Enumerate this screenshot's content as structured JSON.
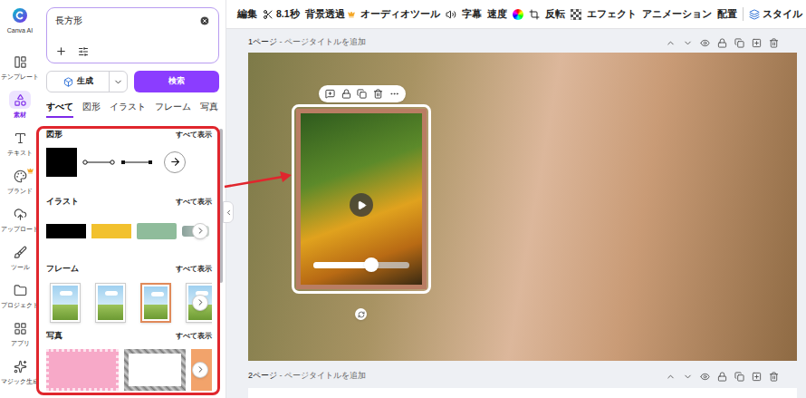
{
  "rail": {
    "logo": "Canva AI",
    "items": [
      {
        "label": "テンプレート",
        "selected": false,
        "premium": false
      },
      {
        "label": "素材",
        "selected": true,
        "premium": false
      },
      {
        "label": "テキスト",
        "selected": false,
        "premium": false
      },
      {
        "label": "ブランド",
        "selected": false,
        "premium": true
      },
      {
        "label": "アップロード",
        "selected": false,
        "premium": false
      },
      {
        "label": "ツール",
        "selected": false,
        "premium": false
      },
      {
        "label": "プロジェクト",
        "selected": false,
        "premium": false
      },
      {
        "label": "アプリ",
        "selected": false,
        "premium": false
      },
      {
        "label": "マジック生成",
        "selected": false,
        "premium": false
      }
    ]
  },
  "search": {
    "value": "長方形"
  },
  "buttons": {
    "generate": "生成",
    "search": "検索"
  },
  "tabs": [
    {
      "label": "すべて",
      "selected": true
    },
    {
      "label": "図形",
      "selected": false
    },
    {
      "label": "イラスト",
      "selected": false
    },
    {
      "label": "フレーム",
      "selected": false
    },
    {
      "label": "写真",
      "selected": false
    }
  ],
  "sections": [
    {
      "title": "図形",
      "see_all": "すべて表示",
      "kind": "shapes"
    },
    {
      "title": "イラスト",
      "see_all": "すべて表示",
      "kind": "illustrations"
    },
    {
      "title": "フレーム",
      "see_all": "すべて表示",
      "kind": "frames"
    },
    {
      "title": "写真",
      "see_all": "すべて表示",
      "kind": "photos"
    }
  ],
  "toolbar": [
    {
      "kind": "text",
      "label": "編集"
    },
    {
      "kind": "scissors",
      "label": "8.1秒"
    },
    {
      "kind": "crown",
      "label": "背景透過"
    },
    {
      "kind": "text",
      "label": "オーディオツール"
    },
    {
      "kind": "speaker"
    },
    {
      "kind": "text",
      "label": "字幕"
    },
    {
      "kind": "text",
      "label": "速度"
    },
    {
      "kind": "color"
    },
    {
      "kind": "crop"
    },
    {
      "kind": "text",
      "label": "反転"
    },
    {
      "kind": "checker"
    },
    {
      "kind": "text",
      "label": "エフェクト"
    },
    {
      "kind": "text",
      "label": "アニメーション"
    },
    {
      "kind": "text",
      "label": "配置"
    },
    {
      "kind": "style",
      "label": "スタイル"
    }
  ],
  "pages": [
    {
      "number": "1ページ",
      "separator": " - ",
      "title": "ページタイトルを追加"
    },
    {
      "number": "2ページ",
      "separator": " - ",
      "title": "ページタイトルを追加"
    }
  ],
  "video": {
    "level": 0.6
  }
}
